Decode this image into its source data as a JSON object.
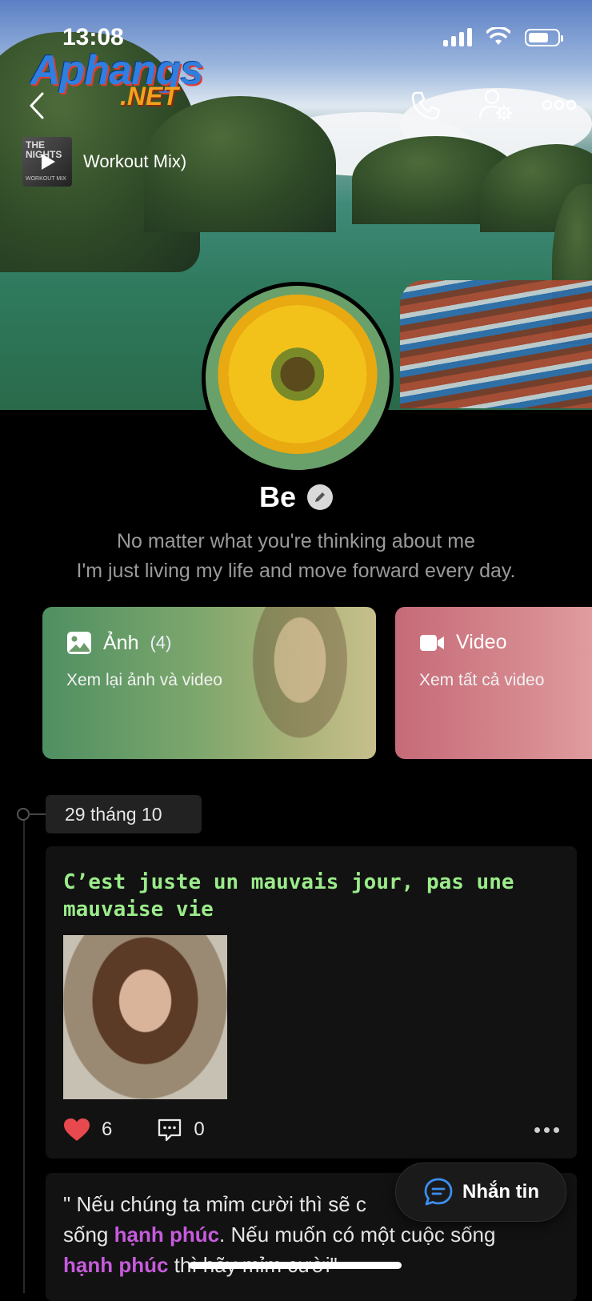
{
  "status_bar": {
    "time": "13:08"
  },
  "watermark": {
    "brand": "Aphangs",
    "suffix": ".NET"
  },
  "header": {
    "back_icon": "chevron-left-icon",
    "call_icon": "phone-icon",
    "settings_icon": "user-gear-icon",
    "more_icon": "ellipsis-icon"
  },
  "music": {
    "title": "Workout Mix)",
    "thumb_text": "THE NIGHTS",
    "thumb_sub": "WORKOUT MIX"
  },
  "profile": {
    "name": "Be",
    "bio_line1": "No matter what you're thinking about me",
    "bio_line2": "I'm just living my life and move forward every day."
  },
  "media_cards": {
    "photos": {
      "title": "Ảnh",
      "count": "(4)",
      "subtitle": "Xem lại ảnh và video"
    },
    "videos": {
      "title": "Video",
      "subtitle": "Xem tất cả video"
    }
  },
  "timeline": {
    "date": "29 tháng 10",
    "post": {
      "text": "C’est juste un mauvais jour, pas une mauvaise vie",
      "likes": "6",
      "comments": "0"
    },
    "quote_post": {
      "part1": "\" Nếu chúng ta mỉm cười thì sẽ c",
      "part2": "sống ",
      "hl1": "hạnh phúc",
      "part3": ". Nếu muốn có một cuộc sống",
      "hl2": "hạnh phúc",
      "part4": " thì hãy mỉm cười\""
    }
  },
  "chat_button": {
    "label": "Nhắn tin"
  },
  "colors": {
    "accent_green": "#9bec8a",
    "highlight_purple": "#c65bdc",
    "heart_red": "#e8494f"
  }
}
